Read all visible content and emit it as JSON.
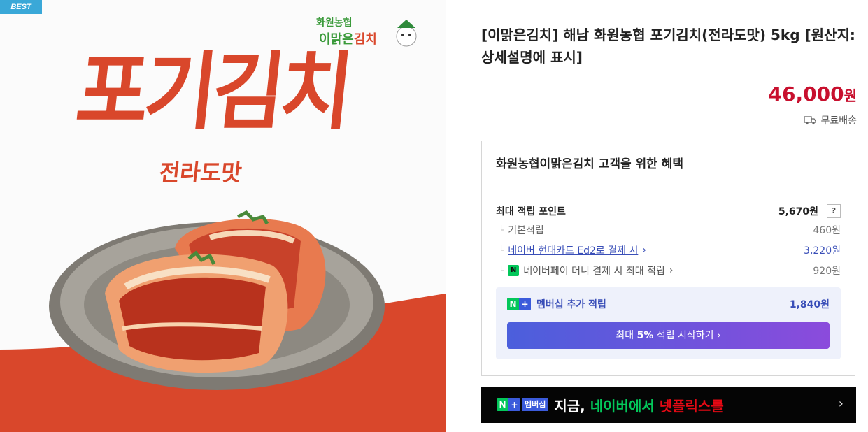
{
  "image": {
    "badge": "BEST",
    "brand_top": "화원농협",
    "brand_bottom_a": "이맑은",
    "brand_bottom_b": "김치",
    "calligraphy_title": "포기김치",
    "calligraphy_subtitle": "전라도맛"
  },
  "product": {
    "title": "[이맑은김치] 해남 화원농협 포기김치(전라도맛) 5kg [원산지:상세설명에 표시]",
    "price_number": "46,000",
    "price_unit": "원",
    "shipping": "무료배송"
  },
  "benefits": {
    "heading": "화원농협이맑은김치 고객을 위한 혜택",
    "max_points_label": "최대 적립 포인트",
    "max_points_value": "5,670원",
    "help": "?",
    "rows": [
      {
        "label": "기본적립",
        "value": "460원"
      },
      {
        "label": "네이버 현대카드 Ed2로 결제 시",
        "value": "3,220원"
      },
      {
        "label": "네이버페이 머니 결제 시 최대 적립",
        "value": "920원"
      }
    ],
    "membership_label": "멤버십 추가 적립",
    "membership_value": "1,840원",
    "start_button_prefix": "최대 ",
    "start_button_bold": "5%",
    "start_button_suffix": " 적립 시작하기",
    "chevron": "›"
  },
  "banner": {
    "n": "N",
    "plus": "+",
    "tag": "멤버십",
    "text_a": "지금, ",
    "text_b": "네이버에서 ",
    "text_c": "넷플릭스를",
    "arrow": "›"
  },
  "colors": {
    "price": "#c8102e",
    "accent_blue": "#3a4fb8",
    "naver_green": "#03c75a",
    "kimchi_red": "#d9472b"
  },
  "icons": [
    "truck-icon",
    "help-icon",
    "chevron-right-icon",
    "npay-icon",
    "mascot-icon"
  ]
}
